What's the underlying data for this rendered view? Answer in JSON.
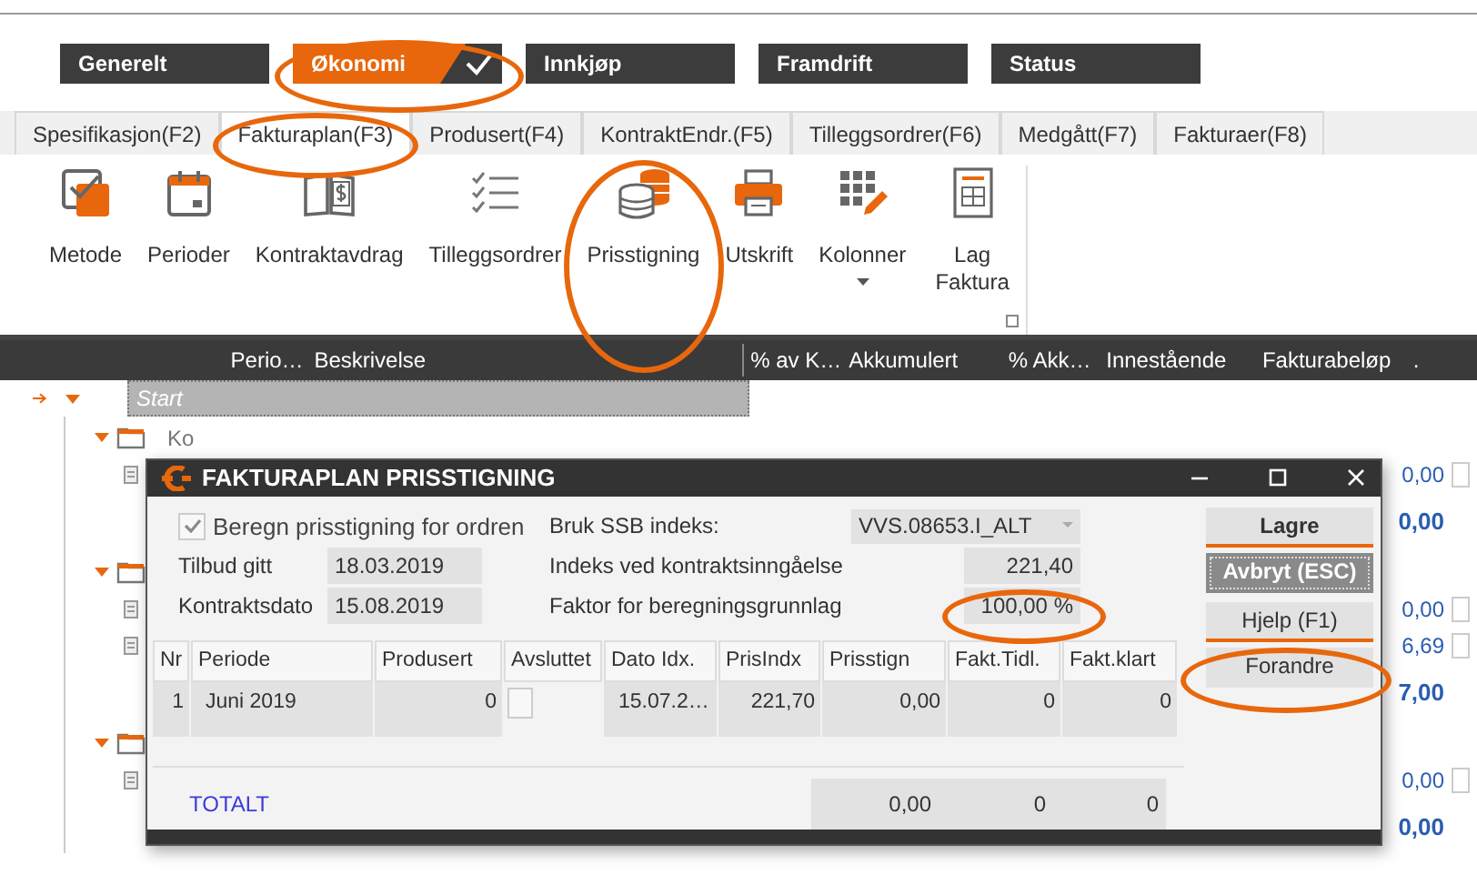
{
  "top_tabs": [
    {
      "label": "Generelt",
      "selected": false,
      "highlighted": false
    },
    {
      "label": "Økonomi",
      "selected": true,
      "highlighted": true
    },
    {
      "label": "Innkjøp",
      "selected": false,
      "highlighted": false
    },
    {
      "label": "Framdrift",
      "selected": false,
      "highlighted": false
    },
    {
      "label": "Status",
      "selected": false,
      "highlighted": false
    }
  ],
  "sub_tabs": [
    {
      "label": "Spesifikasjon(F2)",
      "selected": false,
      "highlighted": false
    },
    {
      "label": "Fakturaplan(F3)",
      "selected": true,
      "highlighted": true
    },
    {
      "label": "Produsert(F4)",
      "selected": false,
      "highlighted": false
    },
    {
      "label": "KontraktEndr.(F5)",
      "selected": false,
      "highlighted": false
    },
    {
      "label": "Tilleggsordrer(F6)",
      "selected": false,
      "highlighted": false
    },
    {
      "label": "Medgått(F7)",
      "selected": false,
      "highlighted": false
    },
    {
      "label": "Fakturaer(F8)",
      "selected": false,
      "highlighted": false
    }
  ],
  "ribbon": {
    "buttons": [
      {
        "label": "Metode",
        "dropdown": false,
        "highlighted": false
      },
      {
        "label": "Perioder",
        "dropdown": false,
        "highlighted": false
      },
      {
        "label": "Kontraktavdrag",
        "dropdown": false,
        "highlighted": false
      },
      {
        "label": "Tilleggsordrer",
        "dropdown": false,
        "highlighted": false
      },
      {
        "label": "Prisstigning",
        "dropdown": false,
        "highlighted": true
      },
      {
        "label": "Utskrift",
        "dropdown": false,
        "highlighted": false
      },
      {
        "label": "Kolonner",
        "dropdown": true,
        "highlighted": false
      },
      {
        "label": "Lag Faktura",
        "dropdown": false,
        "highlighted": false
      }
    ]
  },
  "grid": {
    "columns": [
      "Perio…",
      "Beskrivelse",
      "% av K…",
      "Akkumulert",
      "% Akk…",
      "Innestående",
      "Fakturabeløp",
      "."
    ],
    "rows": [
      {
        "kind": "start",
        "label": "Start",
        "current": true,
        "expanded": true,
        "children": [
          {
            "kind": "folder",
            "current": false,
            "expanded": true,
            "code": "Ko",
            "children": [
              {
                "kind": "doc",
                "current": false,
                "value": "0,00",
                "checked": false
              },
              {
                "kind": "total",
                "current": false,
                "value": "0,00"
              }
            ]
          },
          {
            "kind": "folder",
            "current": false,
            "expanded": true,
            "children": [
              {
                "kind": "doc",
                "current": false,
                "value": "0,00",
                "checked": false
              },
              {
                "kind": "doc",
                "current": false,
                "value": "6,69",
                "checked": false
              },
              {
                "kind": "total",
                "current": false,
                "value": "7,00"
              }
            ]
          },
          {
            "kind": "folder",
            "current": false,
            "expanded": true,
            "children": [
              {
                "kind": "doc",
                "current": false,
                "value": "0,00",
                "checked": false
              },
              {
                "kind": "total",
                "current": false,
                "value": "0,00"
              }
            ]
          }
        ]
      }
    ]
  },
  "dialog": {
    "title": "FAKTURAPLAN PRISSTIGNING",
    "calc_checkbox": {
      "label": "Beregn prisstigning for ordren",
      "checked": true,
      "disabled": true
    },
    "offer_date": {
      "label": "Tilbud gitt",
      "value": "18.03.2019"
    },
    "contract_date": {
      "label": "Kontraktsdato",
      "value": "15.08.2019"
    },
    "ssb_index": {
      "label": "Bruk SSB indeks:",
      "value": "VVS.08653.I_ALT"
    },
    "contract_index": {
      "label": "Indeks ved kontraktsinngåelse",
      "value": "221,40"
    },
    "factor": {
      "label": "Faktor for beregningsgrunnlag",
      "value": "100,00 %",
      "highlighted": true
    },
    "table": {
      "columns": [
        "Nr",
        "Periode",
        "Produsert",
        "Avsluttet",
        "Dato Idx.",
        "PrisIndx",
        "Prisstign",
        "Fakt.Tidl.",
        "Fakt.klart"
      ],
      "rows": [
        {
          "nr": "1",
          "period": "Juni 2019",
          "produced": "0",
          "closed": false,
          "index_date": "15.07.2…",
          "price_index": "221,70",
          "price_increase": "0,00",
          "invoiced_before": "0",
          "invoiced_ready": "0"
        }
      ],
      "total": {
        "label": "TOTALT",
        "price_increase": "0,00",
        "invoiced_before": "0",
        "invoiced_ready": "0"
      }
    },
    "buttons": [
      {
        "label": "Lagre",
        "focused": false,
        "highlighted": false
      },
      {
        "label": "Avbryt (ESC)",
        "focused": true,
        "highlighted": false
      },
      {
        "label": "Hjelp (F1)",
        "focused": false,
        "highlighted": false
      },
      {
        "label": "Forandre",
        "focused": false,
        "highlighted": true
      }
    ]
  }
}
